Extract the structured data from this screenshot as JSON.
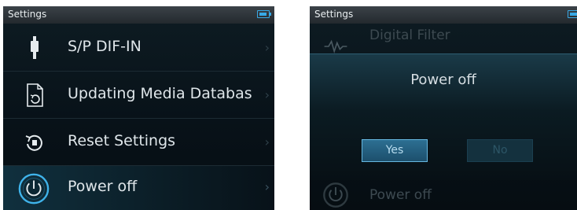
{
  "left_screen": {
    "status_title": "Settings",
    "accent_color": "#38a9e6",
    "items": [
      {
        "label": "S/P DIF-IN",
        "icon": "connector-icon"
      },
      {
        "label": "Updating Media Databas",
        "icon": "database-refresh-icon"
      },
      {
        "label": "Reset Settings",
        "icon": "reset-icon"
      },
      {
        "label": "Power off",
        "icon": "power-icon",
        "selected": true
      }
    ],
    "chevron": "›"
  },
  "right_screen": {
    "status_title": "Settings",
    "background_items": [
      {
        "label": "Digital Filter",
        "icon": "waveform-icon"
      },
      {
        "label": "Power off",
        "icon": "power-icon"
      }
    ],
    "dialog": {
      "title": "Power off",
      "yes_label": "Yes",
      "no_label": "No"
    }
  }
}
